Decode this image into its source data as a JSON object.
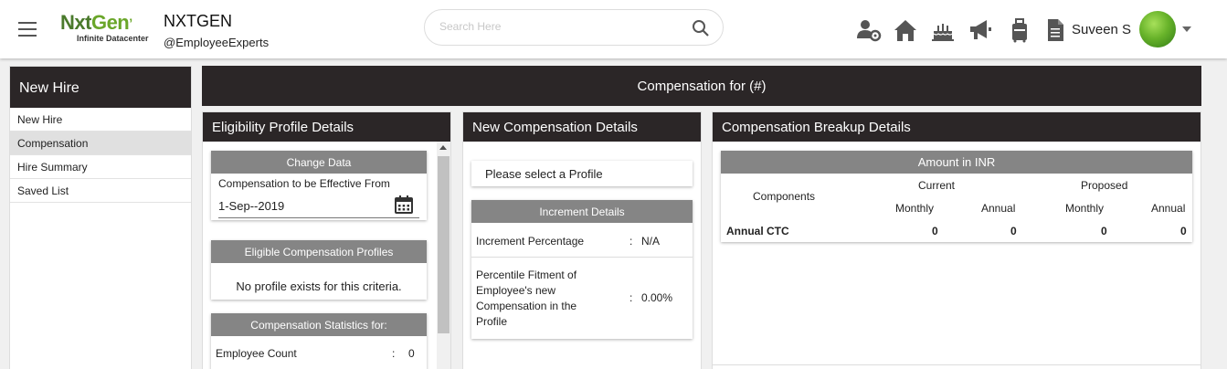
{
  "header": {
    "logo_brand_a": "Nxt",
    "logo_brand_b": "Gen",
    "logo_tagline": "Infinite Datacenter",
    "company_name": "NXTGEN",
    "company_handle": "@EmployeeExperts",
    "search_placeholder": "Search Here",
    "user_name": "Suveen S",
    "icons": [
      "users-gear-icon",
      "home-icon",
      "cake-icon",
      "megaphone-icon",
      "luggage-icon",
      "document-icon"
    ]
  },
  "sidebar": {
    "title": "New Hire",
    "items": [
      {
        "label": "New Hire",
        "active": false
      },
      {
        "label": "Compensation",
        "active": true
      },
      {
        "label": "Hire Summary",
        "active": false
      },
      {
        "label": "Saved List",
        "active": false
      }
    ]
  },
  "main": {
    "title": "Compensation for (#)"
  },
  "eligibility": {
    "title": "Eligibility Profile Details",
    "change_data": {
      "header": "Change Data",
      "label": "Compensation to be Effective From",
      "value": "1-Sep--2019"
    },
    "profiles": {
      "header": "Eligible Compensation Profiles",
      "message": "No profile exists for this criteria."
    },
    "stats": {
      "header": "Compensation Statistics for:",
      "rows": [
        {
          "label": "Employee Count",
          "sep": ":",
          "value": "0"
        }
      ]
    }
  },
  "new_comp": {
    "title": "New Compensation Details",
    "select_profile": "Please select a Profile",
    "increment": {
      "header": "Increment Details",
      "rows": [
        {
          "label": "Increment Percentage",
          "sep": ":",
          "value": "N/A"
        },
        {
          "label": "Percentile Fitment of Employee's new Compensation in the Profile",
          "sep": ":",
          "value": "0.00%"
        }
      ]
    }
  },
  "breakup": {
    "title": "Compensation Breakup Details",
    "amount_header": "Amount in INR",
    "components_label": "Components",
    "current_label": "Current",
    "proposed_label": "Proposed",
    "monthly_label": "Monthly",
    "annual_label": "Annual",
    "rows": [
      {
        "component": "Annual CTC",
        "current_monthly": "0",
        "current_annual": "0",
        "proposed_monthly": "0",
        "proposed_annual": "0"
      }
    ]
  },
  "colors": {
    "dark_header": "#2b2627",
    "card_header": "#858585",
    "brand_green": "#6aa629"
  }
}
